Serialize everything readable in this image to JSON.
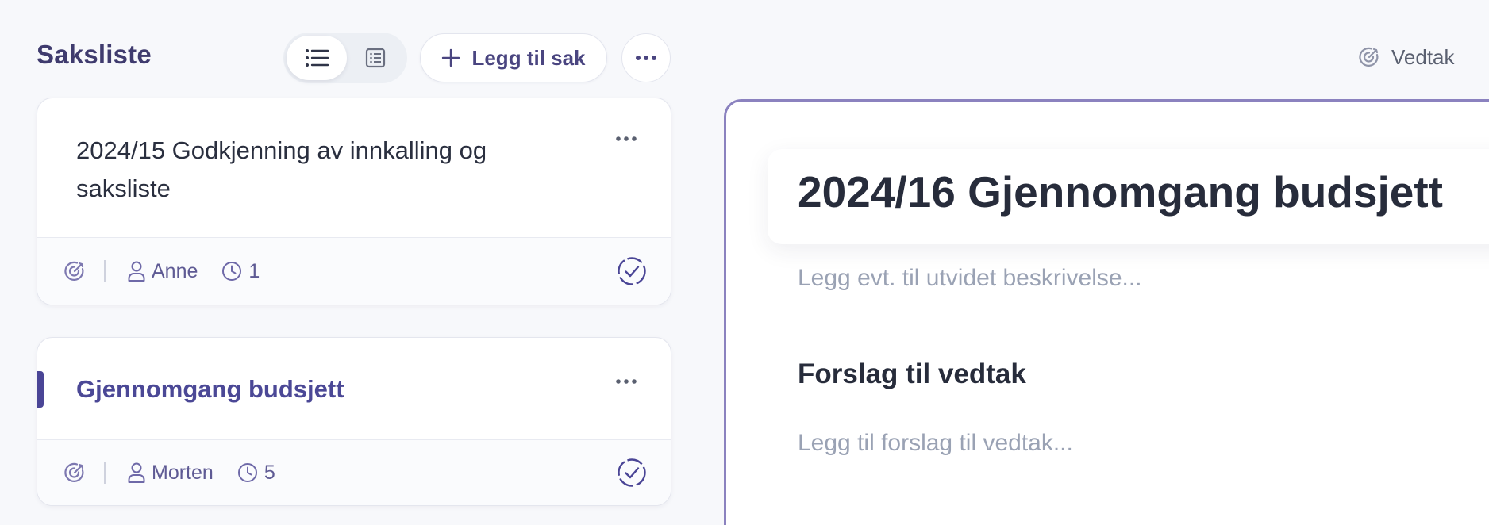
{
  "header": {
    "title": "Saksliste",
    "add_button_label": "Legg til sak",
    "vedtak_label": "Vedtak"
  },
  "cases": [
    {
      "title": "2024/15 Godkjenning av innkalling og saksliste",
      "person": "Anne",
      "duration": "1",
      "active": false
    },
    {
      "title": "Gjennomgang budsjett",
      "person": "Morten",
      "duration": "5",
      "active": true
    }
  ],
  "detail": {
    "title": "2024/16 Gjennomgang budsjett",
    "description_placeholder": "Legg evt. til utvidet beskrivelse...",
    "section_heading": "Forslag til vedtak",
    "proposal_placeholder": "Legg til forslag til vedtak..."
  },
  "colors": {
    "accent": "#4a4596",
    "panel_border": "#8b82bf",
    "placeholder": "#9aa2b4"
  }
}
